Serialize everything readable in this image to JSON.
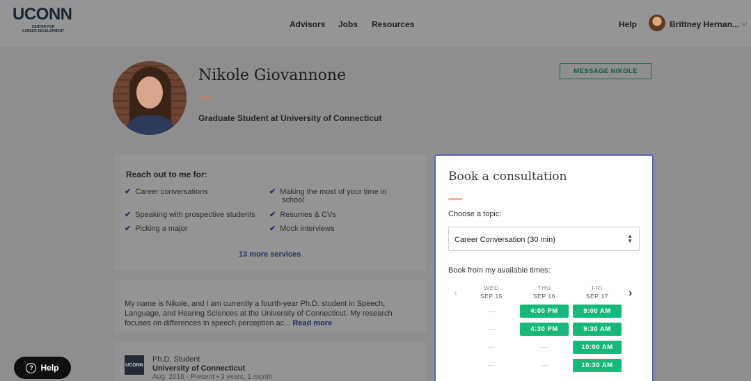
{
  "nav": {
    "logo_word": "UCONN",
    "logo_sub_line1": "CENTER FOR",
    "logo_sub_line2": "CAREER DEVELOPMENT",
    "links": [
      "Advisors",
      "Jobs",
      "Resources"
    ],
    "help": "Help",
    "user_name": "Brittney Hernan...",
    "chevron": "⌵"
  },
  "profile": {
    "name": "Nikole Giovannone",
    "subtitle": "Graduate Student at University of Connecticut",
    "message_button": "MESSAGE NIKOLE"
  },
  "reach": {
    "title": "Reach out to me for:",
    "services": [
      "Career conversations",
      "Making the most of your time in school",
      "Speaking with prospective students",
      "Resumes & CVs",
      "Picking a major",
      "Mock interviews"
    ],
    "more": "13 more services"
  },
  "bio": {
    "text": "My name is Nikole, and I am currently a fourth-year Ph.D. student in Speech, Language, and Hearing Sciences at the University of Connecticut. My research focuses on differences in speech perception ac...",
    "read_more": "Read more"
  },
  "education": {
    "logo_text": "UCONN",
    "title": "Ph.D. Student",
    "school": "University of Connecticut",
    "dates": "Aug. 2018 - Present • 3 years, 1 month"
  },
  "booking": {
    "title": "Book a consultation",
    "choose_label": "Choose a topic:",
    "topic_value": "Career Conversation (30 min)",
    "avail_label": "Book from my available times:",
    "prev": "‹",
    "next": "›",
    "days": [
      {
        "dow": "WED",
        "date": "SEP 15"
      },
      {
        "dow": "THU",
        "date": "SEP 16"
      },
      {
        "dow": "FRI",
        "date": "SEP 17"
      }
    ],
    "empty_mark": "—",
    "thu_slots": [
      "4:00 PM",
      "4:30 PM"
    ],
    "fri_slots": [
      "9:00 AM",
      "9:30 AM",
      "10:00 AM",
      "10:30 AM"
    ]
  },
  "help_pill": {
    "icon": "?",
    "label": "Help"
  },
  "colors": {
    "slot_green": "#16b979",
    "panel_border": "#5865b8",
    "accent_dash": "#f0b2a3",
    "message_green": "#1b6b45"
  }
}
